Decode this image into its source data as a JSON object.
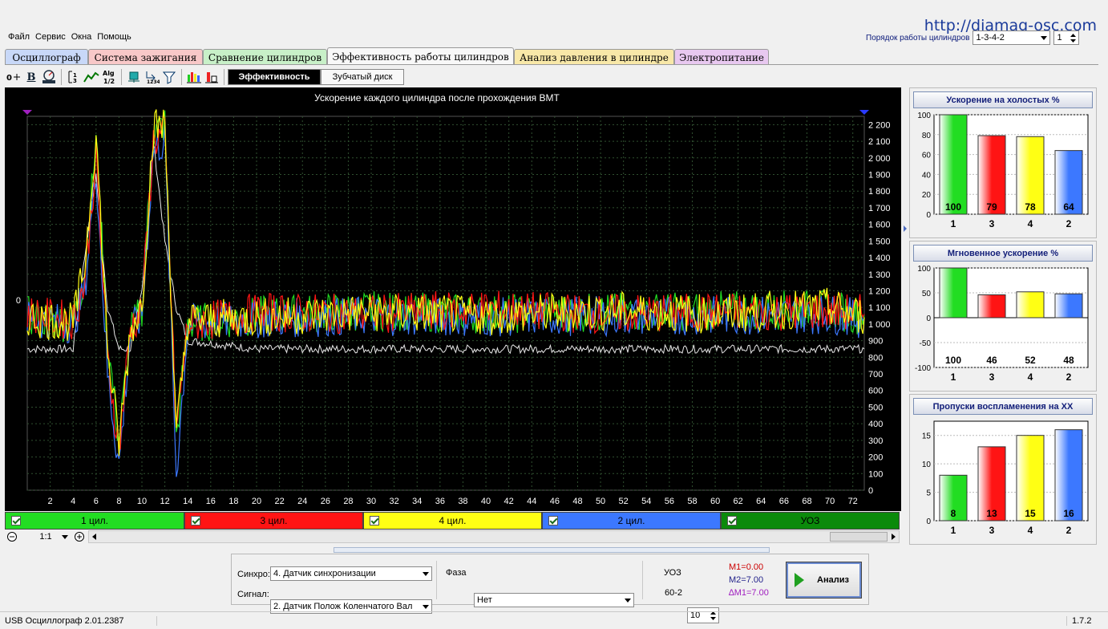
{
  "url_text": "http://diamag-osc.com",
  "menu": [
    "Файл",
    "Сервис",
    "Окна",
    "Помощь"
  ],
  "cyl_order": {
    "label": "Порядок работы цилиндров",
    "value": "1-3-4-2",
    "cyl_value": "1"
  },
  "tabs": [
    {
      "label": "Осциллограф",
      "color": "#c8d8f8"
    },
    {
      "label": "Система зажигания",
      "color": "#f8c8c8"
    },
    {
      "label": "Сравнение цилиндров",
      "color": "#c8f0c8"
    },
    {
      "label": "Эффективность работы цилиндров",
      "color": "#f8f8f8",
      "active": true
    },
    {
      "label": "Анализ давления в цилиндре",
      "color": "#f8e8a8"
    },
    {
      "label": "Электропитание",
      "color": "#e8c8f0"
    }
  ],
  "subtabs": [
    {
      "label": "Эффективность",
      "active": true
    },
    {
      "label": "Зубчатый диск",
      "active": false
    }
  ],
  "toolbar_icons": [
    "zero-offset-icon",
    "bold-icon",
    "rpm-icon",
    "range-icon",
    "smooth-icon",
    "algorithm-icon",
    "cylinder-icon",
    "numbering-icon",
    "filter-icon",
    "bar-chart-icon",
    "bar-single-icon"
  ],
  "toolbar_text": {
    "algo_top": "Alg",
    "algo_bottom": "1/2",
    "bold": "B",
    "numbering": "1234"
  },
  "plot": {
    "title": "Ускорение каждого цилиндра после прохождения ВМТ",
    "zero_label": "0",
    "y_ticks": [
      "2 200",
      "2 100",
      "2 000",
      "1 900",
      "1 800",
      "1 700",
      "1 600",
      "1 500",
      "1 400",
      "1 300",
      "1 200",
      "1 100",
      "1 000",
      "900",
      "800",
      "700",
      "600",
      "500",
      "400",
      "300",
      "200",
      "100",
      "0"
    ],
    "x_ticks": [
      "2",
      "4",
      "6",
      "8",
      "10",
      "12",
      "14",
      "16",
      "18",
      "20",
      "22",
      "24",
      "26",
      "28",
      "30",
      "32",
      "34",
      "36",
      "38",
      "40",
      "42",
      "44",
      "46",
      "48",
      "50",
      "52",
      "54",
      "56",
      "58",
      "60",
      "62",
      "64",
      "66",
      "68",
      "70",
      "72"
    ]
  },
  "channels": [
    {
      "label": "1 цил.",
      "color": "#22dd22"
    },
    {
      "label": "3 цил.",
      "color": "#ff1414"
    },
    {
      "label": "4 цил.",
      "color": "#ffff14"
    },
    {
      "label": "2 цил.",
      "color": "#3c78ff"
    },
    {
      "label": "УОЗ",
      "color": "#0b8a0b"
    }
  ],
  "zoom": {
    "value": "1:1"
  },
  "panels": [
    {
      "title": "Ускорение на холостых %",
      "y_ticks": [
        "100",
        "80",
        "60",
        "40",
        "20",
        "0"
      ],
      "ylim": [
        0,
        100
      ],
      "categories": [
        "1",
        "3",
        "4",
        "2"
      ],
      "values": [
        100,
        79,
        78,
        64
      ],
      "labels": [
        "100",
        "79",
        "78",
        "64"
      ]
    },
    {
      "title": "Мгновенное ускорение %",
      "y_ticks": [
        "100",
        "50",
        "0",
        "-50",
        "-100"
      ],
      "ylim": [
        -100,
        100
      ],
      "categories": [
        "1",
        "3",
        "4",
        "2"
      ],
      "values": [
        100,
        46,
        52,
        48
      ],
      "labels": [
        "100",
        "46",
        "52",
        "48"
      ]
    },
    {
      "title": "Пропуски воспламенения на ХХ",
      "y_ticks": [
        "15",
        "10",
        "5",
        "0"
      ],
      "ylim": [
        0,
        17.5
      ],
      "categories": [
        "1",
        "3",
        "4",
        "2"
      ],
      "values": [
        8,
        13,
        15,
        16
      ],
      "labels": [
        "8",
        "13",
        "15",
        "16"
      ]
    }
  ],
  "bar_colors": [
    "#22dd22",
    "#ff1414",
    "#ffff14",
    "#3c78ff"
  ],
  "bottom": {
    "sync_label": "Синхро:",
    "sync_value": "4.  Датчик синхронизации",
    "signal_label": "Сигнал:",
    "signal_value": "2.  Датчик Полож Коленчатого Вал",
    "phase_label": "Фаза",
    "phase_value": "Нет",
    "uoz_label": "УОЗ",
    "uoz_value": "10",
    "wheel": "60-2",
    "m1": "M1=0.00",
    "m2": "M2=7.00",
    "dm1": "∆M1=7.00",
    "analyze": "Анализ"
  },
  "status": {
    "app": "USB Осциллограф  2.01.2387",
    "version": "1.7.2"
  },
  "chart_data": [
    {
      "type": "bar",
      "title": "Ускорение на холостых %",
      "categories": [
        "1",
        "3",
        "4",
        "2"
      ],
      "values": [
        100,
        79,
        78,
        64
      ],
      "ylim": [
        0,
        100
      ]
    },
    {
      "type": "bar",
      "title": "Мгновенное ускорение %",
      "categories": [
        "1",
        "3",
        "4",
        "2"
      ],
      "values": [
        100,
        46,
        52,
        48
      ],
      "ylim": [
        -100,
        100
      ]
    },
    {
      "type": "bar",
      "title": "Пропуски воспламенения на ХХ",
      "categories": [
        "1",
        "3",
        "4",
        "2"
      ],
      "values": [
        8,
        13,
        15,
        16
      ],
      "ylim": [
        0,
        17.5
      ]
    },
    {
      "type": "line",
      "title": "Ускорение каждого цилиндра после прохождения ВМТ",
      "xlim": [
        0,
        73
      ],
      "ylim": [
        0,
        2250
      ],
      "series": [
        {
          "name": "1 цил.",
          "x": [
            0,
            4,
            5,
            6,
            7,
            8,
            9,
            10,
            11,
            12,
            13,
            14,
            20,
            30,
            40,
            50,
            60,
            70,
            73
          ],
          "y": [
            1050,
            1000,
            1300,
            2100,
            900,
            300,
            950,
            1100,
            2150,
            2200,
            300,
            1000,
            1050,
            1080,
            1060,
            1070,
            1080,
            1090,
            1050
          ]
        },
        {
          "name": "3 цил.",
          "x": [
            0,
            4,
            5,
            6,
            7,
            8,
            9,
            10,
            11,
            12,
            13,
            14,
            20,
            30,
            40,
            50,
            60,
            70,
            73
          ],
          "y": [
            1060,
            1020,
            1250,
            2000,
            800,
            250,
            980,
            1080,
            2100,
            2150,
            350,
            1000,
            1070,
            1060,
            1090,
            1060,
            1070,
            1080,
            1060
          ]
        },
        {
          "name": "4 цил.",
          "x": [
            0,
            4,
            5,
            6,
            7,
            8,
            9,
            10,
            11,
            12,
            13,
            14,
            20,
            30,
            40,
            50,
            60,
            70,
            73
          ],
          "y": [
            1040,
            1010,
            1350,
            2150,
            850,
            280,
            960,
            1120,
            2180,
            2200,
            320,
            1020,
            1040,
            1070,
            1050,
            1080,
            1060,
            1100,
            1040
          ]
        },
        {
          "name": "2 цил.",
          "x": [
            0,
            4,
            5,
            6,
            7,
            8,
            9,
            10,
            11,
            12,
            13,
            14,
            20,
            30,
            40,
            50,
            60,
            70,
            73
          ],
          "y": [
            1030,
            1000,
            1200,
            1950,
            700,
            150,
            950,
            1050,
            2050,
            2100,
            100,
            1000,
            1030,
            1050,
            1040,
            1050,
            1050,
            1060,
            1030
          ]
        },
        {
          "name": "УОЗ",
          "x": [
            0,
            4,
            5,
            6,
            7,
            8,
            9,
            10,
            11,
            12,
            13,
            14,
            20,
            30,
            40,
            50,
            60,
            70,
            73
          ],
          "y": [
            850,
            850,
            1400,
            1900,
            1100,
            850,
            850,
            1200,
            2100,
            1500,
            1100,
            900,
            850,
            850,
            850,
            850,
            850,
            850,
            850
          ]
        }
      ]
    }
  ]
}
